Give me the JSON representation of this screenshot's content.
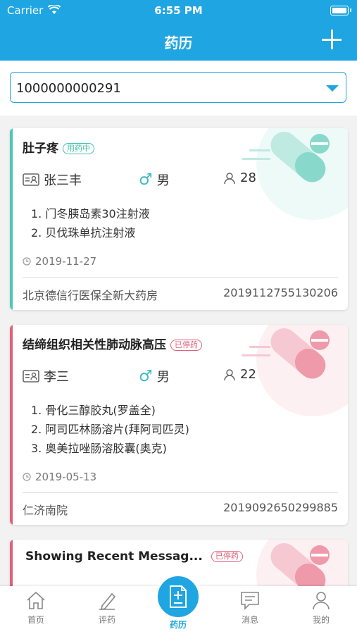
{
  "status": {
    "carrier": "Carrier",
    "time": "6:55 PM"
  },
  "nav": {
    "title": "药历"
  },
  "search": {
    "value": "1000000000291"
  },
  "cards": [
    {
      "title": "肚子疼",
      "status": "用药中",
      "status_color": "#3cc0a8",
      "accent": "#4cc7b5",
      "name": "张三丰",
      "gender": "男",
      "age": "28",
      "drugs": [
        "1. 门冬胰岛素30注射液",
        "2. 贝伐珠单抗注射液"
      ],
      "date": "2019-11-27",
      "pharmacy": "北京德信行医保全新大药房",
      "code": "2019112755130206"
    },
    {
      "title": "结缔组织相关性肺动脉高压",
      "status": "已停药",
      "status_color": "#e0607a",
      "accent": "#e0607a",
      "name": "李三",
      "gender": "男",
      "age": "22",
      "drugs": [
        "1. 骨化三醇胶丸(罗盖全)",
        "2. 阿司匹林肠溶片(拜阿司匹灵)",
        "3. 奥美拉唑肠溶胶囊(奥克)"
      ],
      "date": "2019-05-13",
      "pharmacy": "仁济南院",
      "code": "2019092650299885"
    },
    {
      "title": "Showing Recent Messag...",
      "status": "已停药",
      "status_color": "#e0607a",
      "accent": "#e0607a"
    }
  ],
  "tabs": [
    {
      "label": "首页",
      "icon": "home-icon"
    },
    {
      "label": "评药",
      "icon": "pen-icon"
    },
    {
      "label": "药历",
      "icon": "document-icon"
    },
    {
      "label": "消息",
      "icon": "message-icon"
    },
    {
      "label": "我的",
      "icon": "user-icon"
    }
  ]
}
